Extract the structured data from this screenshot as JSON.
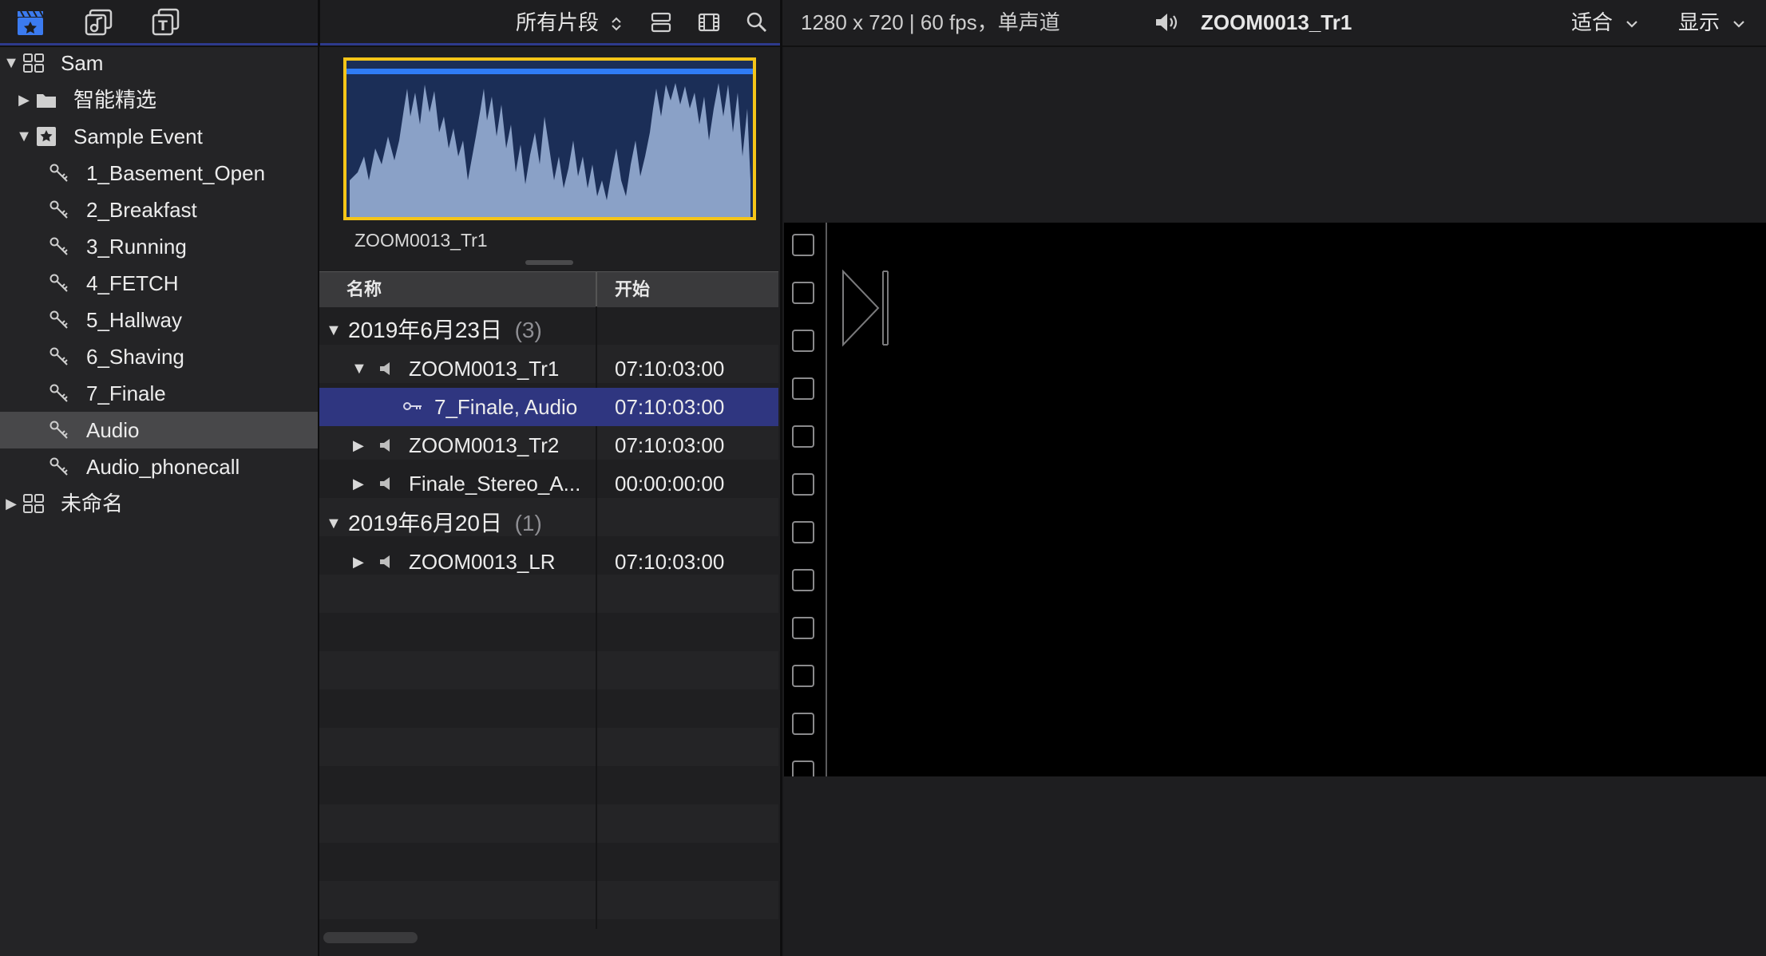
{
  "toolbar": {
    "filter_label": "所有片段",
    "format_info": "1280 x 720 | 60 fps，单声道",
    "clip_name": "ZOOM0013_Tr1",
    "zoom_label": "适合",
    "view_label": "显示"
  },
  "sidebar": {
    "items": [
      {
        "label": "Sam"
      },
      {
        "label": "智能精选"
      },
      {
        "label": "Sample Event"
      },
      {
        "label": "1_Basement_Open"
      },
      {
        "label": "2_Breakfast"
      },
      {
        "label": "3_Running"
      },
      {
        "label": "4_FETCH"
      },
      {
        "label": "5_Hallway"
      },
      {
        "label": "6_Shaving"
      },
      {
        "label": "7_Finale"
      },
      {
        "label": "Audio"
      },
      {
        "label": "Audio_phonecall"
      },
      {
        "label": "未命名"
      }
    ]
  },
  "browser": {
    "thumbnail_name": "ZOOM0013_Tr1",
    "columns": {
      "name": "名称",
      "start": "开始"
    },
    "rows": [
      {
        "name": "2019年6月23日",
        "count": "(3)",
        "start": ""
      },
      {
        "name": "ZOOM0013_Tr1",
        "start": "07:10:03:00"
      },
      {
        "name": "7_Finale, Audio",
        "start": "07:10:03:00"
      },
      {
        "name": "ZOOM0013_Tr2",
        "start": "07:10:03:00"
      },
      {
        "name": "Finale_Stereo_A...",
        "start": "00:00:00:00"
      },
      {
        "name": "2019年6月20日",
        "count": "(1)",
        "start": ""
      },
      {
        "name": "ZOOM0013_LR",
        "start": "07:10:03:00"
      }
    ]
  }
}
